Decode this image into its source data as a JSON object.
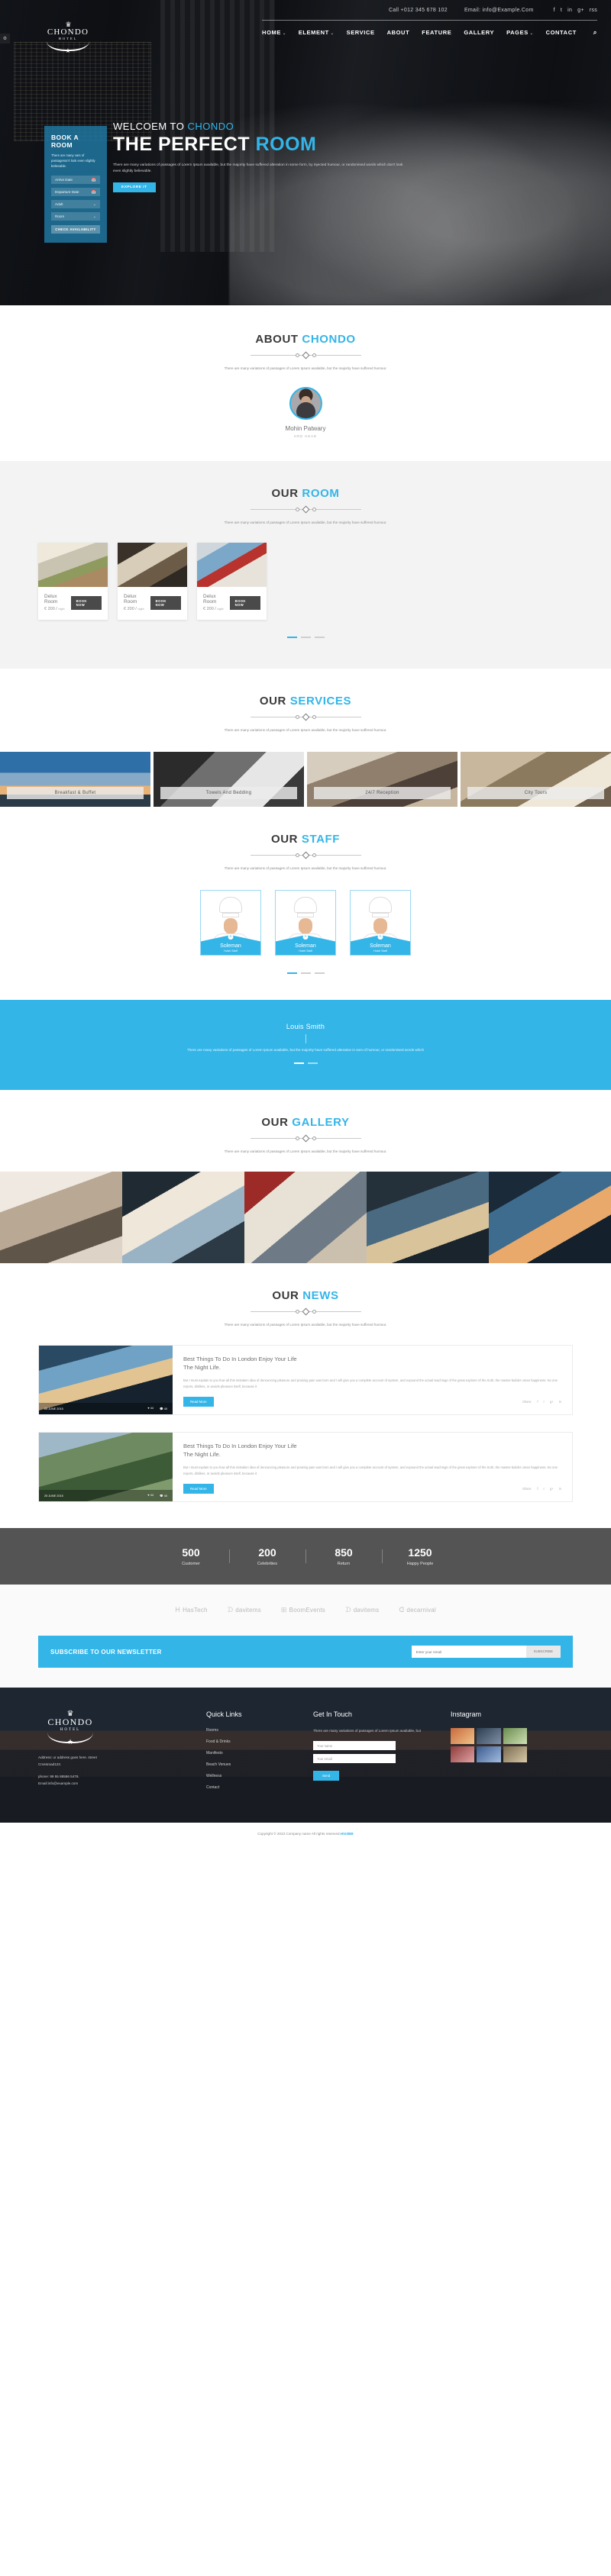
{
  "topbar": {
    "phone": "Call +012 345 678 102",
    "email": "Email: info@Example.Com",
    "socials": [
      "f",
      "t",
      "in",
      "g+",
      "rss"
    ]
  },
  "brand": {
    "name": "CHONDO",
    "sub": "HOTEL"
  },
  "nav": {
    "items": [
      {
        "label": "HOME",
        "caret": "⌄"
      },
      {
        "label": "ELEMENT",
        "caret": "⌄"
      },
      {
        "label": "SERVICE",
        "caret": ""
      },
      {
        "label": "ABOUT",
        "caret": ""
      },
      {
        "label": "FEATURE",
        "caret": ""
      },
      {
        "label": "GALLERY",
        "caret": ""
      },
      {
        "label": "PAGES",
        "caret": "⌄"
      },
      {
        "label": "CONTACT",
        "caret": ""
      }
    ],
    "search_icon": "⌕"
  },
  "hero": {
    "welcome_prefix": "WELCOEM TO ",
    "welcome_brand": "CHONDO",
    "title_prefix": "THE PERFECT ",
    "title_accent": "ROOM",
    "lead": "There are many variations of passages of Lorem Ipsum available, but the majority have suffered alteration in some form, by injected humour, or randomised words which don't look even slightly believable.",
    "cta": "EXPLORE IT"
  },
  "booking": {
    "title": "BOOK A ROOM",
    "desc": "There are many vars of passageson't look even slightly believable.",
    "fields": [
      {
        "label": "Arrive Date",
        "icon": "📅"
      },
      {
        "label": "Departure Date",
        "icon": "📅"
      },
      {
        "label": "Adult",
        "icon": "⌄"
      },
      {
        "label": "Room",
        "icon": "⌄"
      }
    ],
    "submit": "CHECK AVAILABILITY"
  },
  "about": {
    "title_prefix": "ABOUT ",
    "title_accent": "CHONDO",
    "sub": "There are many variations of passages of Lorem Ipsum available, but the majority have suffered humour.",
    "person_name": "Mohin Patwary",
    "person_role": "HRD HEAD"
  },
  "rooms": {
    "title_prefix": "OUR ",
    "title_accent": "ROOM",
    "sub": "There are many variations of passages of Lorem Ipsum available, but the majority have suffered humour.",
    "cards": [
      {
        "name": "Delux Room",
        "price": "€ 200 /",
        "unit": "night",
        "cta": "BOOK NOW"
      },
      {
        "name": "Delux Room",
        "price": "€ 200 /",
        "unit": "night",
        "cta": "BOOK NOW"
      },
      {
        "name": "Delux Room",
        "price": "€ 200 /",
        "unit": "night",
        "cta": "BOOK NOW"
      }
    ]
  },
  "services": {
    "title_prefix": "OUR ",
    "title_accent": "SERVICES",
    "sub": "There are many variations of passages of Lorem Ipsum available, but the majority have suffered humour.",
    "cards": [
      {
        "label": "Breakfast & Buffet"
      },
      {
        "label": "Towels And Bedding"
      },
      {
        "label": "24/7 Reception"
      },
      {
        "label": "City Tours"
      }
    ]
  },
  "staff": {
    "title_prefix": "OUR ",
    "title_accent": "STAFF",
    "sub": "There are many variations of passages of Lorem Ipsum available, but the majority have suffered humour.",
    "members": [
      {
        "name": "Soleman",
        "role": "Hotel Staff",
        "plus": "+"
      },
      {
        "name": "Soleman",
        "role": "Hotel Staff",
        "plus": "+"
      },
      {
        "name": "Soleman",
        "role": "Hotel Staff",
        "plus": "+"
      }
    ]
  },
  "testimonial": {
    "name": "Louis Smith",
    "text": "There are many variations of passages of Lorem Ipsum available, but the majority have suffered alteration in som of humour, or randomised words which"
  },
  "gallery": {
    "title_prefix": "OUR ",
    "title_accent": "GALLERY",
    "sub": "There are many variations of passages of Lorem Ipsum available, but the majority have suffered humour."
  },
  "news": {
    "title_prefix": "OUR ",
    "title_accent": "NEWS",
    "sub": "There are many variations of passages of Lorem Ipsum available, but the majority have suffered humour.",
    "items": [
      {
        "date": "25 JUNE 2015",
        "likes": "44",
        "comments": "40",
        "title_l1": "Best Things To Do In London Enjoy Your Life",
        "title_l2": "The Night Life.",
        "body": "But I must explain to you how all this mistaken idea of denouncing pleasure and praising pain was born and I will give you a complete account of system, and expound the actual teachings of the great explorer of the truth, the master-builder uman happiness. No one rejects, dislikes, or avoids pleasure itself, because it",
        "cta": "Read More",
        "share_label": "Share:",
        "share_icons": [
          "f",
          "r",
          "g+",
          "in"
        ]
      },
      {
        "date": "25 JUNE 2015",
        "likes": "44",
        "comments": "40",
        "title_l1": "Best Things To Do In London Enjoy Your Life",
        "title_l2": "The Night Life.",
        "body": "But I must explain to you how all this mistaken idea of denouncing pleasure and praising pain was born and I will give you a complete account of system, and expound the actual teachings of the great explorer of the truth, the master-builder uman happiness. No one rejects, dislikes, or avoids pleasure itself, because it",
        "cta": "Read More",
        "share_label": "Share:",
        "share_icons": [
          "f",
          "r",
          "g+",
          "in"
        ]
      }
    ]
  },
  "counters": [
    {
      "num": "500",
      "label": "Customer"
    },
    {
      "num": "200",
      "label": "Celebrities"
    },
    {
      "num": "850",
      "label": "Return"
    },
    {
      "num": "1250",
      "label": "Happy People"
    }
  ],
  "brands": [
    {
      "mark": "ᕼ",
      "text": "HasTech"
    },
    {
      "mark": "ᗪ",
      "text": "davitems"
    },
    {
      "mark": "⊞",
      "text": "BoomEvents"
    },
    {
      "mark": "ᗪ",
      "text": "davitems"
    },
    {
      "mark": "ᗡ",
      "text": "decarnival"
    }
  ],
  "newsletter": {
    "title": "SUBSCRIBE TO OUR NEWSLETTER",
    "placeholder": "Enter your email",
    "button": "SUBSCRIBE"
  },
  "footer": {
    "address_l1": "Address: ur address goes here. street",
    "address_l2": "Crossroad123.",
    "phone": "phone: 99 55 88586 5478.",
    "email": "Email:info@example.com",
    "quick_links_title": "Quick Links",
    "quick_links": [
      "Rooms",
      "Food & Drinks",
      "Manifesto",
      "Beach Venues",
      "Wellness",
      "Contact"
    ],
    "contact_title": "Get In Touch",
    "contact_desc": "There are many variations of passages of Lorem Ipsum available, but",
    "name_placeholder": "Your name",
    "email_placeholder": "Your email",
    "send_button": "Send",
    "instagram_title": "Instagram"
  },
  "copyright": {
    "text": "Copyright © 2023 Company name All rights reserved.",
    "link": "HtmlBB"
  },
  "colors": {
    "accent": "#33b5e8",
    "dark": "#545454",
    "booking": "#2076a0"
  }
}
